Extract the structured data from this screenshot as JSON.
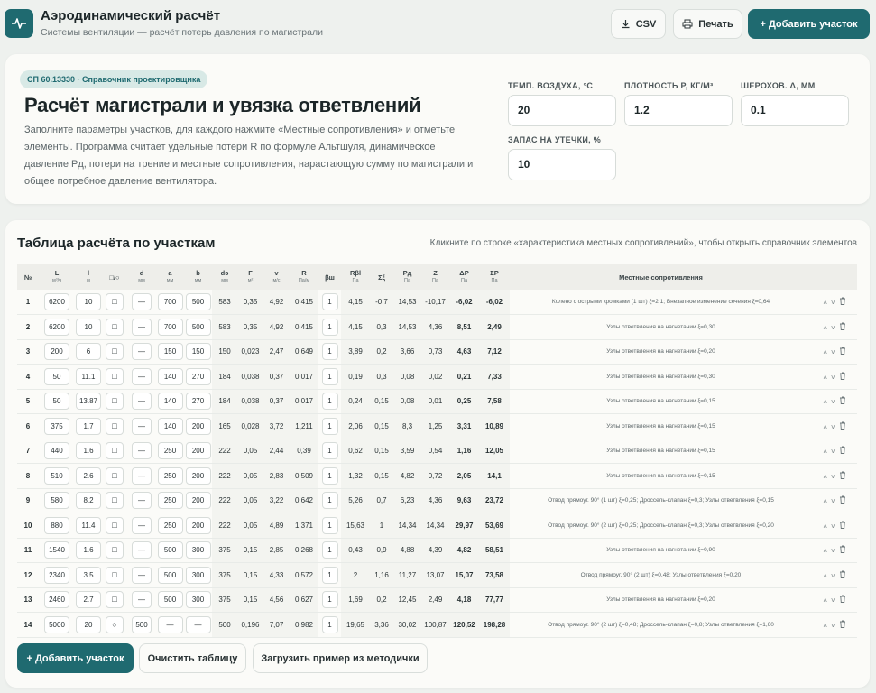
{
  "header": {
    "title": "Аэродинамический расчёт",
    "subtitle": "Системы вентиляции — расчёт потерь давления по магистрали",
    "csv": "CSV",
    "print": "Печать",
    "add": "+ Добавить участок"
  },
  "hero": {
    "badge": "СП 60.13330 · Справочник проектировщика",
    "title": "Расчёт магистрали и увязка ответвлений",
    "desc": "Заполните параметры участков, для каждого нажмите «Местные сопротивления» и отметьте элементы. Программа считает удельные потери R по формуле Альтшуля, динамическое давление Pд, потери на трение и местные сопротивления, нарастающую сумму по магистрали и общее потребное давление вентилятора."
  },
  "params": {
    "temp_label": "ТЕМП. ВОЗДУХА, °С",
    "temp": "20",
    "dens_label": "ПЛОТНОСТЬ Ρ, КГ/М³",
    "dens": "1.2",
    "rough_label": "ШЕРОХОВ. Δ, ММ",
    "rough": "0.1",
    "leak_label": "ЗАПАС НА УТЕЧКИ, %",
    "leak": "10"
  },
  "table": {
    "title": "Таблица расчёта по участкам",
    "hint": "Кликните по строке «характеристика местных сопротивлений», чтобы открыть справочник элементов",
    "headers": [
      [
        "№",
        ""
      ],
      [
        "L",
        "м³/ч"
      ],
      [
        "l",
        "м"
      ],
      [
        "□/○",
        ""
      ],
      [
        "d",
        "мм"
      ],
      [
        "a",
        "мм"
      ],
      [
        "b",
        "мм"
      ],
      [
        "dэ",
        "мм"
      ],
      [
        "F",
        "м²"
      ],
      [
        "v",
        "м/с"
      ],
      [
        "R",
        "Па/м"
      ],
      [
        "βш",
        ""
      ],
      [
        "Rβl",
        "Па"
      ],
      [
        "Σξ",
        ""
      ],
      [
        "Pд",
        "Па"
      ],
      [
        "Z",
        "Па"
      ],
      [
        "ΔP",
        "Па"
      ],
      [
        "ΣP",
        "Па"
      ],
      [
        "Местные сопротивления",
        ""
      ]
    ],
    "rows": [
      [
        "1",
        "6200",
        "10",
        "□",
        "—",
        "700",
        "500",
        "583",
        "0,35",
        "4,92",
        "0,415",
        "1",
        "4,15",
        "-0,7",
        "14,53",
        "-10,17",
        "-6,02",
        "-6,02",
        "Колено с острыми кромками (1 шт) ξ=2,1; Внезапное изменение сечения ξ=0,64"
      ],
      [
        "2",
        "6200",
        "10",
        "□",
        "—",
        "700",
        "500",
        "583",
        "0,35",
        "4,92",
        "0,415",
        "1",
        "4,15",
        "0,3",
        "14,53",
        "4,36",
        "8,51",
        "2,49",
        "Узлы ответвления на нагнетании ξ=0,30"
      ],
      [
        "3",
        "200",
        "6",
        "□",
        "—",
        "150",
        "150",
        "150",
        "0,023",
        "2,47",
        "0,649",
        "1",
        "3,89",
        "0,2",
        "3,66",
        "0,73",
        "4,63",
        "7,12",
        "Узлы ответвления на нагнетании ξ=0,20"
      ],
      [
        "4",
        "50",
        "11.1",
        "□",
        "—",
        "140",
        "270",
        "184",
        "0,038",
        "0,37",
        "0,017",
        "1",
        "0,19",
        "0,3",
        "0,08",
        "0,02",
        "0,21",
        "7,33",
        "Узлы ответвления на нагнетании ξ=0,30"
      ],
      [
        "5",
        "50",
        "13.87",
        "□",
        "—",
        "140",
        "270",
        "184",
        "0,038",
        "0,37",
        "0,017",
        "1",
        "0,24",
        "0,15",
        "0,08",
        "0,01",
        "0,25",
        "7,58",
        "Узлы ответвления на нагнетании ξ=0,15"
      ],
      [
        "6",
        "375",
        "1.7",
        "□",
        "—",
        "140",
        "200",
        "165",
        "0,028",
        "3,72",
        "1,211",
        "1",
        "2,06",
        "0,15",
        "8,3",
        "1,25",
        "3,31",
        "10,89",
        "Узлы ответвления на нагнетании ξ=0,15"
      ],
      [
        "7",
        "440",
        "1.6",
        "□",
        "—",
        "250",
        "200",
        "222",
        "0,05",
        "2,44",
        "0,39",
        "1",
        "0,62",
        "0,15",
        "3,59",
        "0,54",
        "1,16",
        "12,05",
        "Узлы ответвления на нагнетании ξ=0,15"
      ],
      [
        "8",
        "510",
        "2.6",
        "□",
        "—",
        "250",
        "200",
        "222",
        "0,05",
        "2,83",
        "0,509",
        "1",
        "1,32",
        "0,15",
        "4,82",
        "0,72",
        "2,05",
        "14,1",
        "Узлы ответвления на нагнетании ξ=0,15"
      ],
      [
        "9",
        "580",
        "8.2",
        "□",
        "—",
        "250",
        "200",
        "222",
        "0,05",
        "3,22",
        "0,642",
        "1",
        "5,26",
        "0,7",
        "6,23",
        "4,36",
        "9,63",
        "23,72",
        "Отвод прямоуг. 90° (1 шт) ξ=0,25; Дроссель-клапан ξ=0,3; Узлы ответвления ξ=0,15"
      ],
      [
        "10",
        "880",
        "11.4",
        "□",
        "—",
        "250",
        "200",
        "222",
        "0,05",
        "4,89",
        "1,371",
        "1",
        "15,63",
        "1",
        "14,34",
        "14,34",
        "29,97",
        "53,69",
        "Отвод прямоуг. 90° (2 шт) ξ=0,25; Дроссель-клапан ξ=0,3; Узлы ответвления ξ=0,20"
      ],
      [
        "11",
        "1540",
        "1.6",
        "□",
        "—",
        "500",
        "300",
        "375",
        "0,15",
        "2,85",
        "0,268",
        "1",
        "0,43",
        "0,9",
        "4,88",
        "4,39",
        "4,82",
        "58,51",
        "Узлы ответвления на нагнетании ξ=0,90"
      ],
      [
        "12",
        "2340",
        "3.5",
        "□",
        "—",
        "500",
        "300",
        "375",
        "0,15",
        "4,33",
        "0,572",
        "1",
        "2",
        "1,16",
        "11,27",
        "13,07",
        "15,07",
        "73,58",
        "Отвод прямоуг. 90° (2 шт) ξ=0,48; Узлы ответвления ξ=0,20"
      ],
      [
        "13",
        "2460",
        "2.7",
        "□",
        "—",
        "500",
        "300",
        "375",
        "0,15",
        "4,56",
        "0,627",
        "1",
        "1,69",
        "0,2",
        "12,45",
        "2,49",
        "4,18",
        "77,77",
        "Узлы ответвления на нагнетании ξ=0,20"
      ],
      [
        "14",
        "5000",
        "20",
        "○",
        "500",
        "—",
        "—",
        "500",
        "0,196",
        "7,07",
        "0,982",
        "1",
        "19,65",
        "3,36",
        "30,02",
        "100,87",
        "120,52",
        "198,28",
        "Отвод прямоуг. 90° (2 шт) ξ=0,48; Дроссель-клапан ξ=0,8; Узлы ответвления ξ=1,60"
      ]
    ]
  },
  "footer": {
    "add": "+ Добавить участок",
    "clear": "Очистить таблицу",
    "load": "Загрузить пример из методички"
  },
  "icons": {
    "row_up": "chevron-up-icon",
    "row_down": "chevron-down-icon",
    "row_delete": "trash-icon"
  }
}
